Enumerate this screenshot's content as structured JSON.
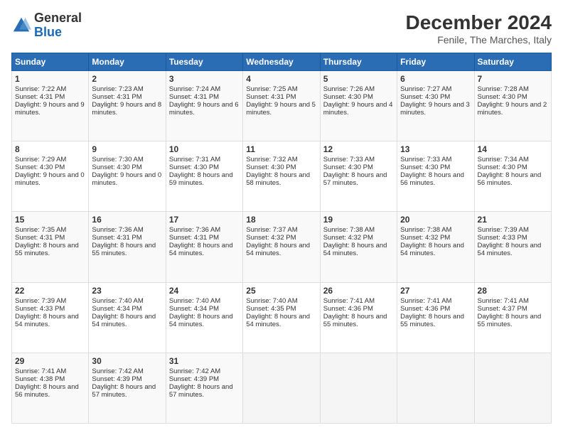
{
  "header": {
    "logo_line1": "General",
    "logo_line2": "Blue",
    "title": "December 2024",
    "subtitle": "Fenile, The Marches, Italy"
  },
  "days_of_week": [
    "Sunday",
    "Monday",
    "Tuesday",
    "Wednesday",
    "Thursday",
    "Friday",
    "Saturday"
  ],
  "weeks": [
    [
      {
        "day": "1",
        "info": "Sunrise: 7:22 AM\nSunset: 4:31 PM\nDaylight: 9 hours and 9 minutes."
      },
      {
        "day": "2",
        "info": "Sunrise: 7:23 AM\nSunset: 4:31 PM\nDaylight: 9 hours and 8 minutes."
      },
      {
        "day": "3",
        "info": "Sunrise: 7:24 AM\nSunset: 4:31 PM\nDaylight: 9 hours and 6 minutes."
      },
      {
        "day": "4",
        "info": "Sunrise: 7:25 AM\nSunset: 4:31 PM\nDaylight: 9 hours and 5 minutes."
      },
      {
        "day": "5",
        "info": "Sunrise: 7:26 AM\nSunset: 4:30 PM\nDaylight: 9 hours and 4 minutes."
      },
      {
        "day": "6",
        "info": "Sunrise: 7:27 AM\nSunset: 4:30 PM\nDaylight: 9 hours and 3 minutes."
      },
      {
        "day": "7",
        "info": "Sunrise: 7:28 AM\nSunset: 4:30 PM\nDaylight: 9 hours and 2 minutes."
      }
    ],
    [
      {
        "day": "8",
        "info": "Sunrise: 7:29 AM\nSunset: 4:30 PM\nDaylight: 9 hours and 0 minutes."
      },
      {
        "day": "9",
        "info": "Sunrise: 7:30 AM\nSunset: 4:30 PM\nDaylight: 9 hours and 0 minutes."
      },
      {
        "day": "10",
        "info": "Sunrise: 7:31 AM\nSunset: 4:30 PM\nDaylight: 8 hours and 59 minutes."
      },
      {
        "day": "11",
        "info": "Sunrise: 7:32 AM\nSunset: 4:30 PM\nDaylight: 8 hours and 58 minutes."
      },
      {
        "day": "12",
        "info": "Sunrise: 7:33 AM\nSunset: 4:30 PM\nDaylight: 8 hours and 57 minutes."
      },
      {
        "day": "13",
        "info": "Sunrise: 7:33 AM\nSunset: 4:30 PM\nDaylight: 8 hours and 56 minutes."
      },
      {
        "day": "14",
        "info": "Sunrise: 7:34 AM\nSunset: 4:30 PM\nDaylight: 8 hours and 56 minutes."
      }
    ],
    [
      {
        "day": "15",
        "info": "Sunrise: 7:35 AM\nSunset: 4:31 PM\nDaylight: 8 hours and 55 minutes."
      },
      {
        "day": "16",
        "info": "Sunrise: 7:36 AM\nSunset: 4:31 PM\nDaylight: 8 hours and 55 minutes."
      },
      {
        "day": "17",
        "info": "Sunrise: 7:36 AM\nSunset: 4:31 PM\nDaylight: 8 hours and 54 minutes."
      },
      {
        "day": "18",
        "info": "Sunrise: 7:37 AM\nSunset: 4:32 PM\nDaylight: 8 hours and 54 minutes."
      },
      {
        "day": "19",
        "info": "Sunrise: 7:38 AM\nSunset: 4:32 PM\nDaylight: 8 hours and 54 minutes."
      },
      {
        "day": "20",
        "info": "Sunrise: 7:38 AM\nSunset: 4:32 PM\nDaylight: 8 hours and 54 minutes."
      },
      {
        "day": "21",
        "info": "Sunrise: 7:39 AM\nSunset: 4:33 PM\nDaylight: 8 hours and 54 minutes."
      }
    ],
    [
      {
        "day": "22",
        "info": "Sunrise: 7:39 AM\nSunset: 4:33 PM\nDaylight: 8 hours and 54 minutes."
      },
      {
        "day": "23",
        "info": "Sunrise: 7:40 AM\nSunset: 4:34 PM\nDaylight: 8 hours and 54 minutes."
      },
      {
        "day": "24",
        "info": "Sunrise: 7:40 AM\nSunset: 4:34 PM\nDaylight: 8 hours and 54 minutes."
      },
      {
        "day": "25",
        "info": "Sunrise: 7:40 AM\nSunset: 4:35 PM\nDaylight: 8 hours and 54 minutes."
      },
      {
        "day": "26",
        "info": "Sunrise: 7:41 AM\nSunset: 4:36 PM\nDaylight: 8 hours and 55 minutes."
      },
      {
        "day": "27",
        "info": "Sunrise: 7:41 AM\nSunset: 4:36 PM\nDaylight: 8 hours and 55 minutes."
      },
      {
        "day": "28",
        "info": "Sunrise: 7:41 AM\nSunset: 4:37 PM\nDaylight: 8 hours and 55 minutes."
      }
    ],
    [
      {
        "day": "29",
        "info": "Sunrise: 7:41 AM\nSunset: 4:38 PM\nDaylight: 8 hours and 56 minutes."
      },
      {
        "day": "30",
        "info": "Sunrise: 7:42 AM\nSunset: 4:39 PM\nDaylight: 8 hours and 57 minutes."
      },
      {
        "day": "31",
        "info": "Sunrise: 7:42 AM\nSunset: 4:39 PM\nDaylight: 8 hours and 57 minutes."
      },
      null,
      null,
      null,
      null
    ]
  ]
}
